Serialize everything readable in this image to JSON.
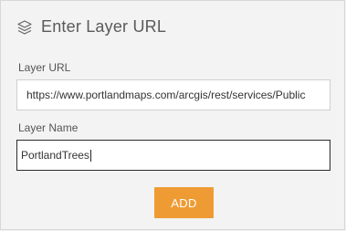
{
  "dialog": {
    "title": "Enter Layer URL",
    "icon": "layers-icon"
  },
  "fields": {
    "url": {
      "label": "Layer URL",
      "value": "https://www.portlandmaps.com/arcgis/rest/services/Public"
    },
    "name": {
      "label": "Layer Name",
      "value": "PortlandTrees"
    }
  },
  "actions": {
    "add_label": "ADD"
  },
  "colors": {
    "accent": "#ef9b33",
    "background": "#f3f3f3"
  }
}
